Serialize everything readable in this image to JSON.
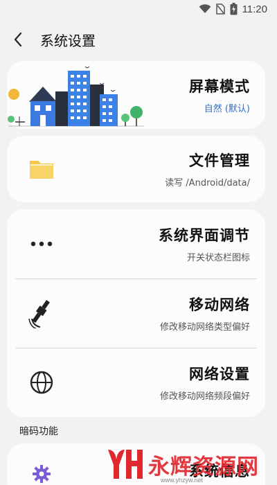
{
  "status_bar": {
    "time": "11:20"
  },
  "header": {
    "title": "系统设置"
  },
  "cards": {
    "screen": {
      "title": "屏幕模式",
      "subtitle": "自然 (默认)"
    },
    "files": {
      "title": "文件管理",
      "subtitle": "读写 /Android/data/"
    },
    "ui_tuner": {
      "title": "系统界面调节",
      "subtitle": "开关状态栏图标"
    },
    "mobile_network": {
      "title": "移动网络",
      "subtitle": "修改移动网络类型偏好"
    },
    "network_settings": {
      "title": "网络设置",
      "subtitle": "修改移动网络频段偏好"
    }
  },
  "sections": {
    "secret_codes": {
      "label": "暗码功能",
      "first_item_title": "系统信息"
    }
  },
  "watermark": {
    "logo_text": "永辉资源网",
    "url": "www.yhzyw.net"
  },
  "colors": {
    "accent": "#2e6ec9",
    "background": "#f2f2f2",
    "card": "#fcfcfc",
    "folder": "#f4c84a",
    "watermark": "#e0282f"
  }
}
